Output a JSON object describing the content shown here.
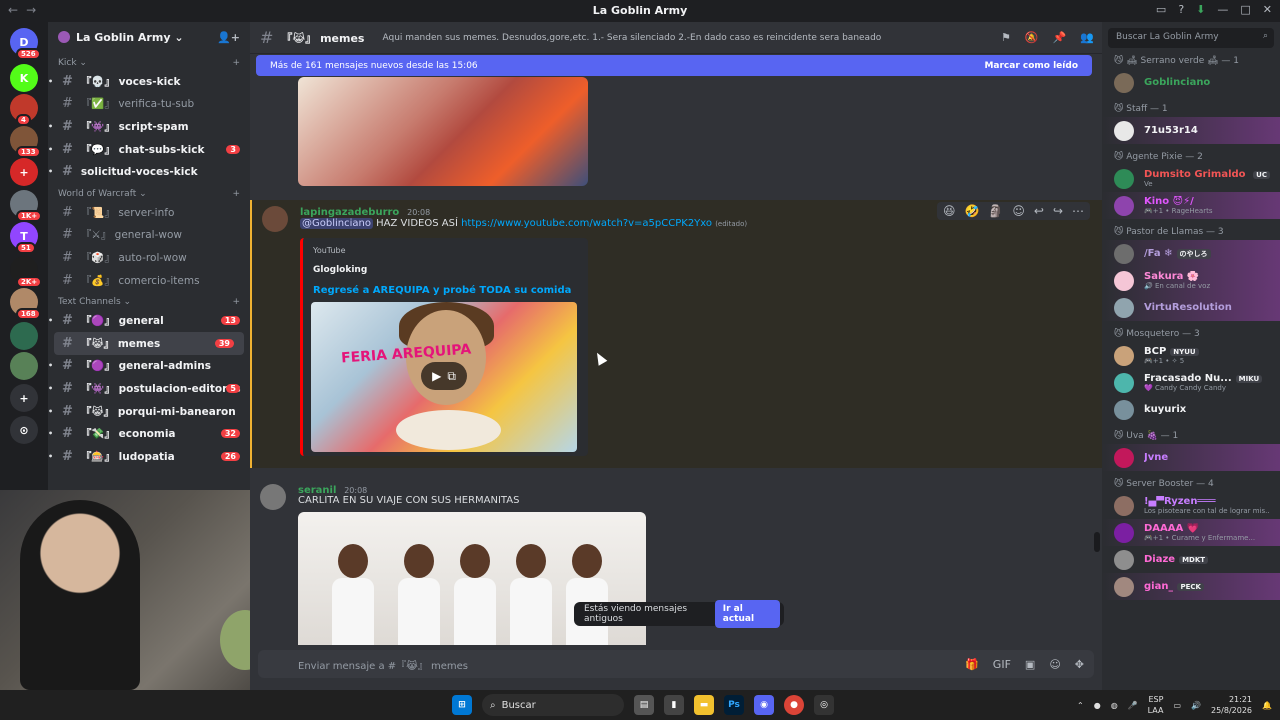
{
  "window": {
    "title": "La Goblin Army",
    "nav_back": "←",
    "nav_fwd": "→"
  },
  "servers": [
    {
      "badge": "526",
      "color": "#5865f2",
      "glyph": "D"
    },
    {
      "badge": "",
      "color": "#53fc18",
      "glyph": "K"
    },
    {
      "badge": "4",
      "color": "#c0392b",
      "glyph": ""
    },
    {
      "badge": "133",
      "color": "#7f5539",
      "glyph": ""
    },
    {
      "badge": "",
      "color": "#d62828",
      "glyph": "+"
    },
    {
      "badge": "1K+",
      "color": "#6c757d",
      "glyph": ""
    },
    {
      "badge": "51",
      "color": "#9146ff",
      "glyph": "T"
    },
    {
      "badge": "2K+",
      "color": "#1f1f1f",
      "glyph": ""
    },
    {
      "badge": "168",
      "color": "#b08968",
      "glyph": ""
    },
    {
      "badge": "",
      "color": "#2d6a4f",
      "glyph": ""
    },
    {
      "badge": "",
      "color": "#588157",
      "glyph": ""
    }
  ],
  "server_add": "+",
  "server_explore": "⊙",
  "guild": {
    "name": "La Goblin Army ⌄"
  },
  "categories": {
    "kick": "Kick ⌄",
    "wow": "World of Warcraft ⌄",
    "text": "Text Channels ⌄"
  },
  "channels": {
    "kick": [
      {
        "name": "『💀』 voces-kick",
        "bold": true,
        "count": ""
      },
      {
        "name": "『✅』 verifica-tu-sub",
        "bold": false,
        "count": ""
      },
      {
        "name": "『👾』 script-spam",
        "bold": true,
        "count": ""
      },
      {
        "name": "『💬』 chat-subs-kick",
        "bold": true,
        "count": "3"
      },
      {
        "name": "solicitud-voces-kick",
        "bold": true,
        "count": ""
      }
    ],
    "wow": [
      {
        "name": "『📜』 server-info",
        "bold": false,
        "count": ""
      },
      {
        "name": "『⚔』 general-wow",
        "bold": false,
        "count": ""
      },
      {
        "name": "『🎲』 auto-rol-wow",
        "bold": false,
        "count": ""
      },
      {
        "name": "『💰』 comercio-items",
        "bold": false,
        "count": ""
      }
    ],
    "text": [
      {
        "name": "『🟣』 general",
        "bold": true,
        "count": "13"
      },
      {
        "name": "『😹』 memes",
        "bold": true,
        "count": "39",
        "active": true
      },
      {
        "name": "『🟣』 general-admins",
        "bold": true,
        "count": ""
      },
      {
        "name": "『👾』 postulacion-editores",
        "bold": true,
        "count": "5"
      },
      {
        "name": "『😹』 porqui-mi-banearon",
        "bold": true,
        "count": ""
      },
      {
        "name": "『💸』 economia",
        "bold": true,
        "count": "32"
      },
      {
        "name": "『🎰』 ludopatia",
        "bold": true,
        "count": "26"
      }
    ]
  },
  "channel_header": {
    "name": "『😹』 memes",
    "topic": "Aqui manden sus memes. Desnudos,gore,etc. 1.- Sera silenciado 2.-En dado caso es reincidente sera baneado"
  },
  "new_messages": {
    "text": "Más de 161 mensajes nuevos desde las 15:06",
    "mark": "Marcar como leído"
  },
  "messages": {
    "m2": {
      "author": "lapingazadeburro",
      "author_color": "#3ba55c",
      "time": "20:08",
      "mention": "@Goblinciano",
      "text": " HAZ VIDEOS ASÍ ",
      "link": "https://www.youtube.com/watch?v=a5pCCPK2Yxo",
      "edited": "(editado)",
      "embed": {
        "provider": "YouTube",
        "author": "Glogloking",
        "title": "Regresé a AREQUIPA y probé TODA su comida",
        "thumb_text": "FERIA AREQUIPA"
      }
    },
    "m3": {
      "author": "seranil",
      "author_color": "#3ba55c",
      "time": "20:08",
      "text": "CARLITA EN SU VIAJE CON SUS HERMANITAS"
    }
  },
  "old_messages": {
    "text": "Estás viendo mensajes antiguos",
    "button": "Ir al actual"
  },
  "composer": {
    "placeholder": "Enviar mensaje a #『😹』 memes"
  },
  "member_search": {
    "placeholder": "Buscar La Goblin Army"
  },
  "member_groups": [
    {
      "title": "😼 🛋 Serrano verde 🛋 — 1",
      "members": [
        {
          "name": "Goblinciano",
          "color": "#3ba55c",
          "sub": "",
          "tag": "",
          "banner": false,
          "avatar": "#7a6a58"
        }
      ]
    },
    {
      "title": "😼 Staff — 1",
      "members": [
        {
          "name": "71u53r14",
          "color": "#f2f3f5",
          "sub": "",
          "tag": "",
          "banner": true,
          "avatar": "#e8e8e8"
        }
      ]
    },
    {
      "title": "😼 Agente Pixie — 2",
      "members": [
        {
          "name": "Dumsito Grimaldo ...",
          "color": "#f25555",
          "sub": "Ve",
          "tag": "UC",
          "banner": false,
          "avatar": "#2e8b57"
        },
        {
          "name": "Kino 😈⚡/",
          "color": "#e056fd",
          "sub": "🎮+1 • RageHearts",
          "tag": "",
          "banner": true,
          "avatar": "#8e44ad"
        }
      ]
    },
    {
      "title": "😼 Pastor de Llamas — 3",
      "members": [
        {
          "name": "/Fa ❄",
          "color": "#b39ddb",
          "sub": "",
          "tag": "のやしろ",
          "banner": true,
          "avatar": "#6d6d6d"
        },
        {
          "name": "Sakura 🌸",
          "color": "#ff8ad8",
          "sub": "🔊 En canal de voz",
          "tag": "",
          "banner": true,
          "avatar": "#f5c6d6"
        },
        {
          "name": "VirtuResolution",
          "color": "#b39ddb",
          "sub": "",
          "tag": "",
          "banner": true,
          "avatar": "#90a4ae"
        }
      ]
    },
    {
      "title": "😼 Mosquetero — 3",
      "members": [
        {
          "name": "BCP",
          "color": "#f2f3f5",
          "sub": "🎮+1 • ✧ 5",
          "tag": "NYUU",
          "banner": false,
          "avatar": "#c9a27a"
        },
        {
          "name": "Fracasado Nu...",
          "color": "#f2f3f5",
          "sub": "💜 Candy Candy Candy",
          "tag": "MIKU",
          "banner": false,
          "avatar": "#4db6ac"
        },
        {
          "name": "kuyurix",
          "color": "#f2f3f5",
          "sub": "",
          "tag": "",
          "banner": false,
          "avatar": "#78909c"
        }
      ]
    },
    {
      "title": "😼 Uva 🍇 — 1",
      "members": [
        {
          "name": "Jvne",
          "color": "#c77dff",
          "sub": "",
          "tag": "",
          "banner": true,
          "avatar": "#c2185b"
        }
      ]
    },
    {
      "title": "😼 Server Booster — 4",
      "members": [
        {
          "name": "!▄▀Ryzen═══",
          "color": "#c77dff",
          "sub": "Los pisoteare con tal de lograr mis...",
          "tag": "",
          "banner": false,
          "avatar": "#8d6e63"
        },
        {
          "name": "DAAAA 💗",
          "color": "#ff6ad5",
          "sub": "🎮+1 • Curame y Enfermame...",
          "tag": "",
          "banner": true,
          "avatar": "#7b1fa2"
        },
        {
          "name": "Diaze",
          "color": "#ff6ad5",
          "sub": "",
          "tag": "MDKT",
          "banner": false,
          "avatar": "#8e8e8e"
        },
        {
          "name": "gian_",
          "color": "#ff6ad5",
          "sub": "",
          "tag": "PECK",
          "banner": true,
          "avatar": "#a1887f"
        }
      ]
    }
  ],
  "taskbar": {
    "search": "Buscar",
    "lang_top": "ESP",
    "lang_bottom": "LAA",
    "time": "21:21",
    "date": "25/8/2026",
    "ps": "Ps"
  },
  "colors": {
    "accent": "#5865f2",
    "unread": "#f23f43",
    "highlight": "#f0b232"
  }
}
